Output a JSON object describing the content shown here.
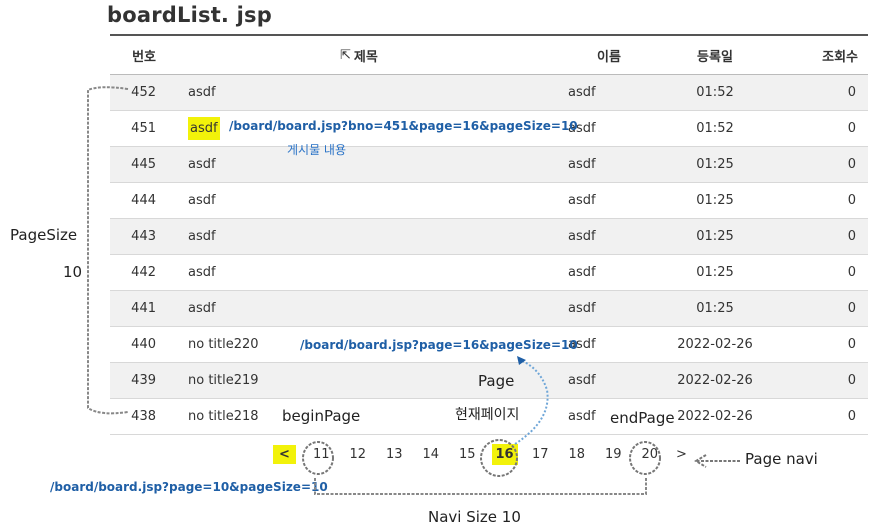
{
  "page_title": "boardList. jsp",
  "headers": {
    "no": "번호",
    "title": "제목",
    "writer": "이름",
    "date": "등록일",
    "views": "조회수"
  },
  "rows": [
    {
      "no": "452",
      "title": "asdf",
      "writer": "asdf",
      "date": "01:52",
      "views": "0"
    },
    {
      "no": "451",
      "title": "asdf",
      "writer": "asdf",
      "date": "01:52",
      "views": "0"
    },
    {
      "no": "445",
      "title": "asdf",
      "writer": "asdf",
      "date": "01:25",
      "views": "0"
    },
    {
      "no": "444",
      "title": "asdf",
      "writer": "asdf",
      "date": "01:25",
      "views": "0"
    },
    {
      "no": "443",
      "title": "asdf",
      "writer": "asdf",
      "date": "01:25",
      "views": "0"
    },
    {
      "no": "442",
      "title": "asdf",
      "writer": "asdf",
      "date": "01:25",
      "views": "0"
    },
    {
      "no": "441",
      "title": "asdf",
      "writer": "asdf",
      "date": "01:25",
      "views": "0"
    },
    {
      "no": "440",
      "title": "no title220",
      "writer": "asdf",
      "date": "2022-02-26",
      "views": "0"
    },
    {
      "no": "439",
      "title": "no title219",
      "writer": "asdf",
      "date": "2022-02-26",
      "views": "0"
    },
    {
      "no": "438",
      "title": "no title218",
      "writer": "asdf",
      "date": "2022-02-26",
      "views": "0"
    }
  ],
  "pagination": {
    "prev": "<",
    "pages": [
      "11",
      "12",
      "13",
      "14",
      "15",
      "16",
      "17",
      "18",
      "19",
      "20"
    ],
    "current": "16",
    "next": ">"
  },
  "annotations": {
    "read_url": "/board/board.jsp?bno=451&page=16&pageSize=10",
    "read_note": "게시물 내용",
    "page_url": "/board/board.jsp?page=16&pageSize=10",
    "prev_url": "/board/board.jsp?page=10&pageSize=10",
    "pagesize_label": "PageSize",
    "pagesize_value": "10",
    "begin_page": "beginPage",
    "end_page": "endPage",
    "page_label": "Page",
    "current_page_label": "현재페이지",
    "page_navi": "Page navi",
    "navi_size": "Navi Size 10"
  },
  "colors": {
    "highlight": "#f2f20a",
    "url_blue": "#1f5fa6"
  }
}
